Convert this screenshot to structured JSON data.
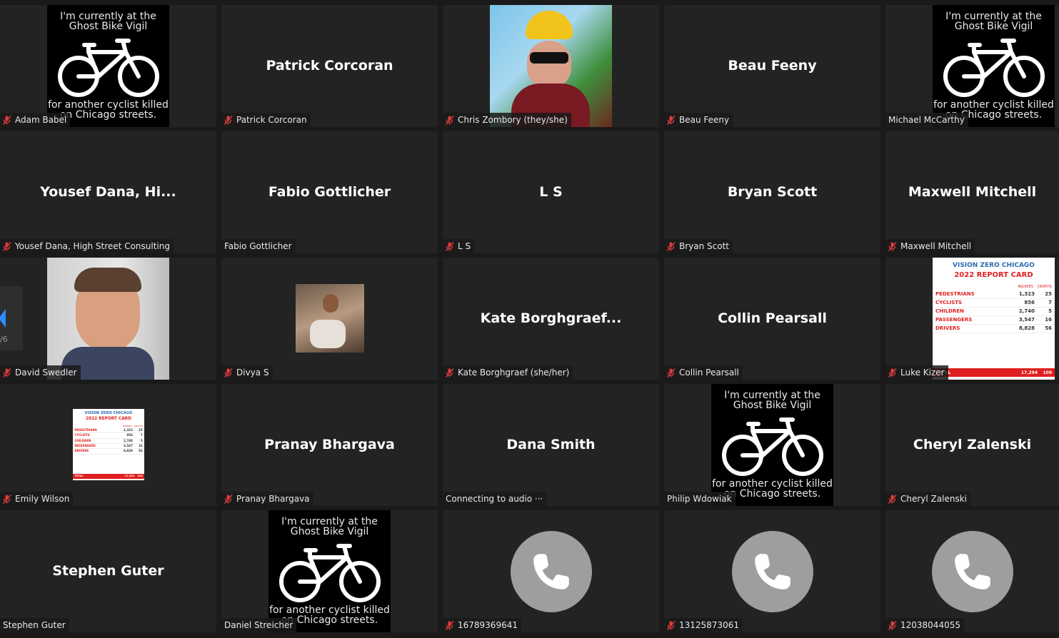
{
  "ghost_image": {
    "line1": "I'm currently at the",
    "line2": "Ghost Bike Vigil",
    "line3": "for another cyclist killed",
    "line4": "on Chicago streets."
  },
  "report_card": {
    "brand": "VISION ZERO CHICAGO",
    "title": "2022 REPORT CARD",
    "headers": [
      "INJURIES",
      "DEATHS"
    ],
    "rows": [
      {
        "label": "PEDESTRIANS",
        "injuries": "1,323",
        "deaths": "25"
      },
      {
        "label": "CYCLISTS",
        "injuries": "856",
        "deaths": "7"
      },
      {
        "label": "CHILDREN",
        "injuries": "2,740",
        "deaths": "5"
      },
      {
        "label": "PASSENGERS",
        "injuries": "3,547",
        "deaths": "16"
      },
      {
        "label": "DRIVERS",
        "injuries": "8,828",
        "deaths": "56"
      }
    ],
    "total_label": "TOTAL",
    "total_injuries": "17,294",
    "total_deaths": "109"
  },
  "pager": {
    "text": "/6"
  },
  "tiles": [
    {
      "big": "",
      "label": "Adam Babel",
      "muted": true
    },
    {
      "big": "Patrick Corcoran",
      "label": "Patrick Corcoran",
      "muted": true
    },
    {
      "big": "",
      "label": "Chris Zombory (they/she)",
      "muted": true
    },
    {
      "big": "Beau Feeny",
      "label": "Beau Feeny",
      "muted": true
    },
    {
      "big": "",
      "label": "Michael McCarthy",
      "muted": false
    },
    {
      "big": "Yousef  Dana,  Hi...",
      "label": "Yousef Dana, High Street Consulting",
      "muted": true
    },
    {
      "big": "Fabio Gottlicher",
      "label": "Fabio Gottlicher",
      "muted": false
    },
    {
      "big": "L S",
      "label": "L S",
      "muted": true
    },
    {
      "big": "Bryan Scott",
      "label": "Bryan Scott",
      "muted": true
    },
    {
      "big": "Maxwell Mitchell",
      "label": "Maxwell Mitchell",
      "muted": true
    },
    {
      "big": "",
      "label": "David Swedler",
      "muted": true
    },
    {
      "big": "",
      "label": "Divya S",
      "muted": true
    },
    {
      "big": "Kate  Borghgraef...",
      "label": "Kate Borghgraef (she/her)",
      "muted": true
    },
    {
      "big": "Collin Pearsall",
      "label": "Collin Pearsall",
      "muted": true
    },
    {
      "big": "",
      "label": "Luke Kizer",
      "muted": true
    },
    {
      "big": "",
      "label": "Emily Wilson",
      "muted": true
    },
    {
      "big": "Pranay Bhargava",
      "label": "Pranay Bhargava",
      "muted": true
    },
    {
      "big": "Dana Smith",
      "label": "Connecting to audio ···",
      "muted": false
    },
    {
      "big": "",
      "label": "Philip Wdowiak",
      "muted": false
    },
    {
      "big": "Cheryl Zalenski",
      "label": "Cheryl Zalenski",
      "muted": true
    },
    {
      "big": "Stephen Guter",
      "label": "Stephen Guter",
      "muted": false
    },
    {
      "big": "",
      "label": "Daniel Streicher",
      "muted": false
    },
    {
      "big": "",
      "label": "16789369641",
      "muted": true
    },
    {
      "big": "",
      "label": "13125873061",
      "muted": true
    },
    {
      "big": "",
      "label": "12038044055",
      "muted": true
    }
  ]
}
